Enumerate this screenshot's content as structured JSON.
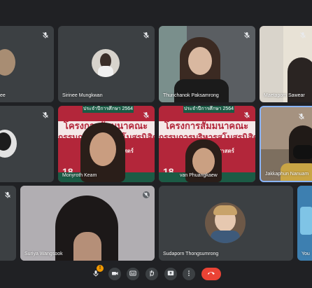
{
  "participants": [
    {
      "name": "ee"
    },
    {
      "name": "Sirinee Mungkwan"
    },
    {
      "name": "Thunchanok Paksamrong"
    },
    {
      "name": "Maetapom Sawear"
    },
    {
      "name": "Monyroth Keam"
    },
    {
      "name": "Jakkaphun Nanuam"
    },
    {
      "name": "Suriya Wangsook"
    },
    {
      "name": "Sudaporn Thongsumrong"
    },
    {
      "name": "You"
    },
    {
      "name": "van Phuangkaew"
    }
  ],
  "slide": {
    "tag": "ประจำปีการศึกษา 2564",
    "line1": "โครงการสัมมนาคณะ",
    "line2": "กรรมการบริหารสโมสรนิสิต",
    "line3": "คณะวิทยาศาสตร์",
    "num": "18",
    "footer": "มหาวิทยาลัยบูรพา"
  },
  "controls": {
    "mic_badge": "!"
  },
  "colors": {
    "end_call": "#ea4335",
    "tile": "#3c4043",
    "background": "#202124"
  },
  "icons": [
    "mic-icon",
    "camera-icon",
    "captions-icon",
    "raise-hand-icon",
    "present-icon",
    "more-icon",
    "end-call-icon",
    "mic-off-icon"
  ]
}
